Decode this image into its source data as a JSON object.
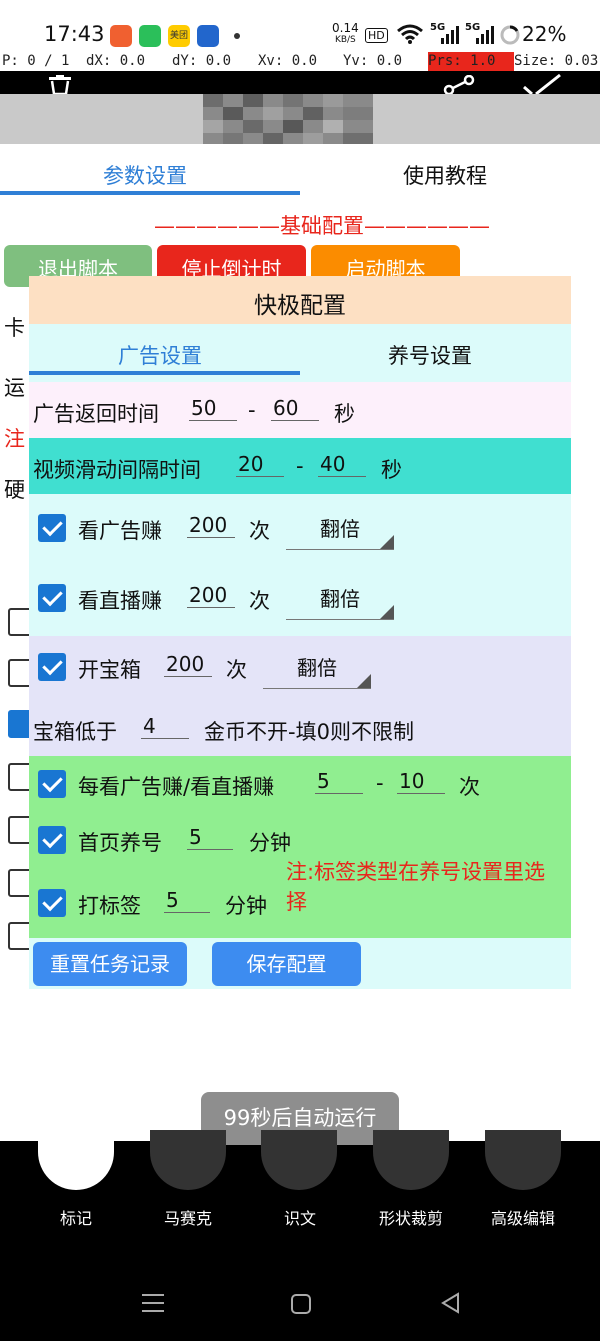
{
  "status": {
    "time": "17:43",
    "net_speed_value": "0.14",
    "net_speed_unit": "KB/S",
    "hd_badge": "HD",
    "signal1": "5G",
    "signal2": "5G",
    "battery": "22%",
    "app_icons": [
      "gallery-app-icon",
      "wechat-app-icon",
      "meituan-app-icon",
      "magnet-app-icon"
    ],
    "meituan_label": "美团"
  },
  "debug": {
    "p": "P: 0 / 1",
    "dx": "dX: 0.0",
    "dy": "dY: 0.0",
    "xv": "Xv: 0.0",
    "yv": "Yv: 0.0",
    "prs": "Prs: 1.0",
    "size": "Size: 0.03",
    "prs_color": "#e8261c"
  },
  "tabs": {
    "params": "参数设置",
    "tutorial": "使用教程",
    "active_color": "#2f7fd6"
  },
  "section_title": "——————基础配置——————",
  "buttons": {
    "exit": "退出脚本",
    "stop": "停止倒计时",
    "start": "启动脚本"
  },
  "left_partial": {
    "row1": "卡",
    "row2": "运",
    "row3": "注",
    "row4": "硬"
  },
  "dialog": {
    "title": "快极配置",
    "tab_ad": "广告设置",
    "tab_account": "养号设置",
    "ad_return_label": "广告返回时间",
    "ad_return_min": "50",
    "ad_return_sep": "-",
    "ad_return_max": "60",
    "ad_return_unit": "秒",
    "swipe_label": "视频滑动间隔时间",
    "swipe_min": "20",
    "swipe_sep": "-",
    "swipe_max": "40",
    "swipe_unit": "秒",
    "watch_ad_label": "看广告赚",
    "watch_ad_count": "200",
    "watch_ad_unit": "次",
    "watch_ad_mode": "翻倍",
    "watch_live_label": "看直播赚",
    "watch_live_count": "200",
    "watch_live_unit": "次",
    "watch_live_mode": "翻倍",
    "chest_label": "开宝箱",
    "chest_count": "200",
    "chest_unit": "次",
    "chest_mode": "翻倍",
    "chest_min_label": "宝箱低于",
    "chest_min_value": "4",
    "chest_min_note": "金币不开-填0则不限制",
    "each_label": "每看广告赚/看直播赚",
    "each_min": "5",
    "each_sep": "-",
    "each_max": "10",
    "each_unit": "次",
    "home_label": "首页养号",
    "home_value": "5",
    "home_unit": "分钟",
    "tag_label": "打标签",
    "tag_value": "5",
    "tag_unit": "分钟",
    "tag_note": "注:标签类型在养号设置里选择",
    "reset_button": "重置任务记录",
    "save_button": "保存配置"
  },
  "toast": "99秒后自动运行",
  "toolbar": {
    "mark": "标记",
    "mosaic": "马赛克",
    "ocr": "识文",
    "crop": "形状裁剪",
    "advanced": "高级编辑"
  },
  "colors": {
    "title_bar": "#fde0c3",
    "ad_return_row": "#fdf0fb",
    "swipe_row": "#40dfd0",
    "chest_row": "#e4e4f8",
    "green_row": "#90ee90",
    "dialog_bg": "#dcfbfa",
    "exit_btn": "#7fbf7f",
    "stop_btn": "#e8261c",
    "start_btn": "#fb8c00",
    "blue_btn": "#3d8cf0"
  }
}
